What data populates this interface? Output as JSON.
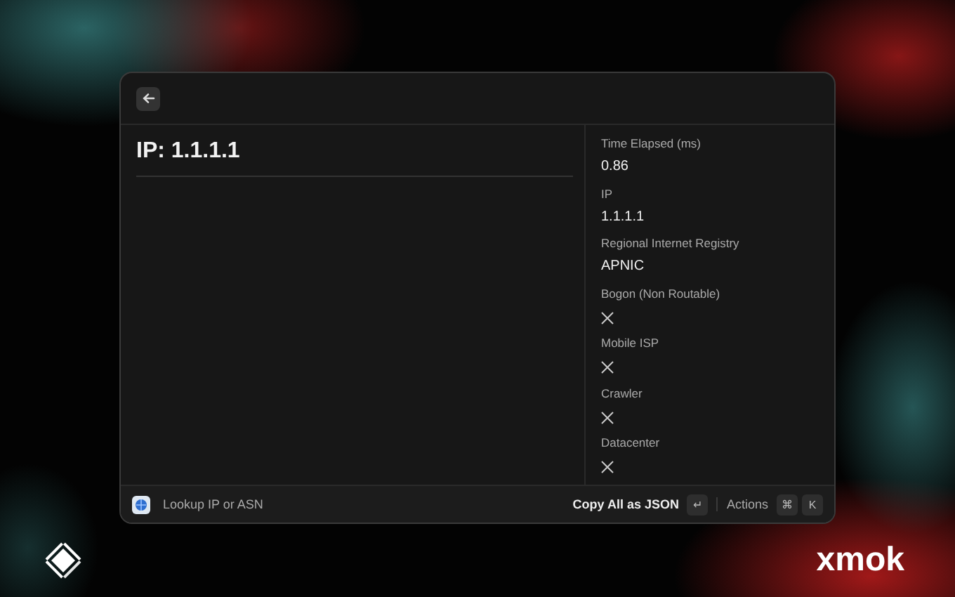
{
  "window": {
    "heading": "IP: 1.1.1.1"
  },
  "details": [
    {
      "label": "Time Elapsed (ms)",
      "kind": "text",
      "value": "0.86"
    },
    {
      "label": "IP",
      "kind": "text",
      "value": "1.1.1.1"
    },
    {
      "label": "Regional Internet Registry",
      "kind": "text",
      "value": "APNIC"
    },
    {
      "label": "Bogon (Non Routable)",
      "kind": "boolean",
      "value": false
    },
    {
      "label": "Mobile ISP",
      "kind": "boolean",
      "value": false
    },
    {
      "label": "Crawler",
      "kind": "boolean",
      "value": false
    },
    {
      "label": "Datacenter",
      "kind": "boolean",
      "value": false
    }
  ],
  "action_bar": {
    "title": "Lookup IP or ASN",
    "primary_action": "Copy All as JSON",
    "primary_key": "↵",
    "actions_label": "Actions",
    "shortcut_keys": [
      "⌘",
      "K"
    ]
  },
  "author": "xmok"
}
